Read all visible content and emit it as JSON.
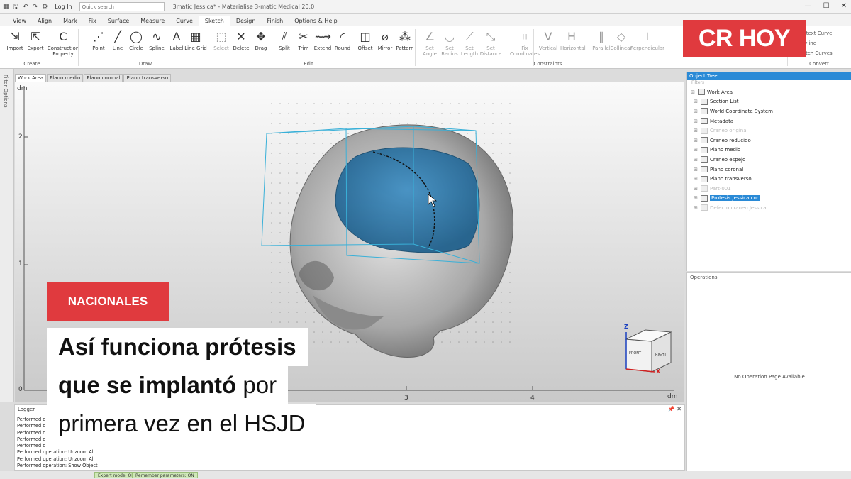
{
  "titlebar": {
    "login": "Log In",
    "search_placeholder": "Quick search",
    "window_title": "3matic Jessica* - Materialise 3-matic Medical 20.0"
  },
  "menu_tabs": [
    "View",
    "Align",
    "Mark",
    "Fix",
    "Surface",
    "Measure",
    "Curve",
    "Sketch",
    "Design",
    "Finish",
    "Options & Help"
  ],
  "active_tab": "Sketch",
  "ribbon": {
    "buttons": [
      {
        "label": "Import",
        "icon": "import-icon"
      },
      {
        "label": "Export",
        "icon": "export-icon"
      },
      {
        "label": "Construction Property",
        "icon": "construction-icon"
      },
      {
        "label": "Point",
        "icon": "point-icon"
      },
      {
        "label": "Line",
        "icon": "line-icon"
      },
      {
        "label": "Circle",
        "icon": "circle-icon"
      },
      {
        "label": "Spline",
        "icon": "spline-icon"
      },
      {
        "label": "Label",
        "icon": "label-icon"
      },
      {
        "label": "Line Grid",
        "icon": "grid-icon"
      },
      {
        "label": "Select",
        "icon": "select-icon"
      },
      {
        "label": "Delete",
        "icon": "delete-icon"
      },
      {
        "label": "Drag",
        "icon": "drag-icon"
      },
      {
        "label": "Split",
        "icon": "split-icon"
      },
      {
        "label": "Trim",
        "icon": "trim-icon"
      },
      {
        "label": "Extend",
        "icon": "extend-icon"
      },
      {
        "label": "Round",
        "icon": "round-icon"
      },
      {
        "label": "Offset",
        "icon": "offset-icon"
      },
      {
        "label": "Mirror",
        "icon": "mirror-icon"
      },
      {
        "label": "Pattern",
        "icon": "pattern-icon"
      },
      {
        "label": "Set Angle",
        "icon": "angle-icon"
      },
      {
        "label": "Set Radius",
        "icon": "radius-icon"
      },
      {
        "label": "Set Length",
        "icon": "length-icon"
      },
      {
        "label": "Set Distance",
        "icon": "distance-icon"
      },
      {
        "label": "Fix Coordinates",
        "icon": "fix-coordinates-icon"
      },
      {
        "label": "Vertical",
        "icon": "vertical-icon"
      },
      {
        "label": "Horizontal",
        "icon": "horizontal-icon"
      },
      {
        "label": "Parallel",
        "icon": "parallel-icon"
      },
      {
        "label": "Collinear",
        "icon": "collinear-icon"
      },
      {
        "label": "Perpendicular",
        "icon": "perpendicular-icon"
      }
    ],
    "groups": [
      "Create",
      "Draw",
      "Edit",
      "Constraints",
      "Convert"
    ],
    "convert_items": [
      "ontext Curve",
      "olyline",
      "ketch Curves"
    ]
  },
  "left_sidebar": "Filter Options",
  "viewport_tabs": [
    "Work Area",
    "Plano medio",
    "Plano coronal",
    "Plano transverso"
  ],
  "viewport": {
    "y_unit": "dm",
    "x_unit": "dm",
    "y_ticks": [
      "2",
      "1",
      "0"
    ],
    "x_ticks": [
      "3",
      "4"
    ],
    "cube": {
      "front": "FRONT",
      "right": "RIGHT",
      "z": "Z",
      "x": "X"
    }
  },
  "object_tree": {
    "header": "Object Tree",
    "filter": "Filters",
    "nodes": [
      {
        "label": "Work Area",
        "state": "normal"
      },
      {
        "label": "Section List",
        "state": "normal"
      },
      {
        "label": "World Coordinate System",
        "state": "normal"
      },
      {
        "label": "Metadata",
        "state": "normal"
      },
      {
        "label": "Craneo original",
        "state": "faded"
      },
      {
        "label": "Craneo reducido",
        "state": "normal"
      },
      {
        "label": "Plano medio",
        "state": "normal"
      },
      {
        "label": "Craneo espejo",
        "state": "normal"
      },
      {
        "label": "Plano coronal",
        "state": "normal"
      },
      {
        "label": "Plano transverso",
        "state": "normal"
      },
      {
        "label": "Part-001",
        "state": "faded"
      },
      {
        "label": "Protesis Jessica cor",
        "state": "selected"
      },
      {
        "label": "Defecto craneo Jessica",
        "state": "faded"
      }
    ]
  },
  "operations": {
    "header": "Operations",
    "empty_text": "No Operation Page Available"
  },
  "logger": {
    "title": "Logger",
    "lines": [
      "Performed o",
      "Performed o",
      "Performed o",
      "Performed o",
      "Performed o",
      "Performed operation: Unzoom All",
      "Performed operation: Unzoom All",
      "Performed operation: Show Object"
    ]
  },
  "statusbar": {
    "expert_mode": "Expert mode: ON",
    "remember_params": "Remember parameters: ON"
  },
  "overlay": {
    "logo": "CR HOY",
    "category": "NACIONALES",
    "headline_1_bold": "Así funciona prótesis",
    "headline_2_bold": "que se implantó",
    "headline_2_rest": " por",
    "headline_3": "primera vez en el HSJD"
  },
  "colors": {
    "accent_red": "#e03a3e",
    "selection_blue": "#2a8ad6",
    "implant_blue": "#1f77b4"
  }
}
